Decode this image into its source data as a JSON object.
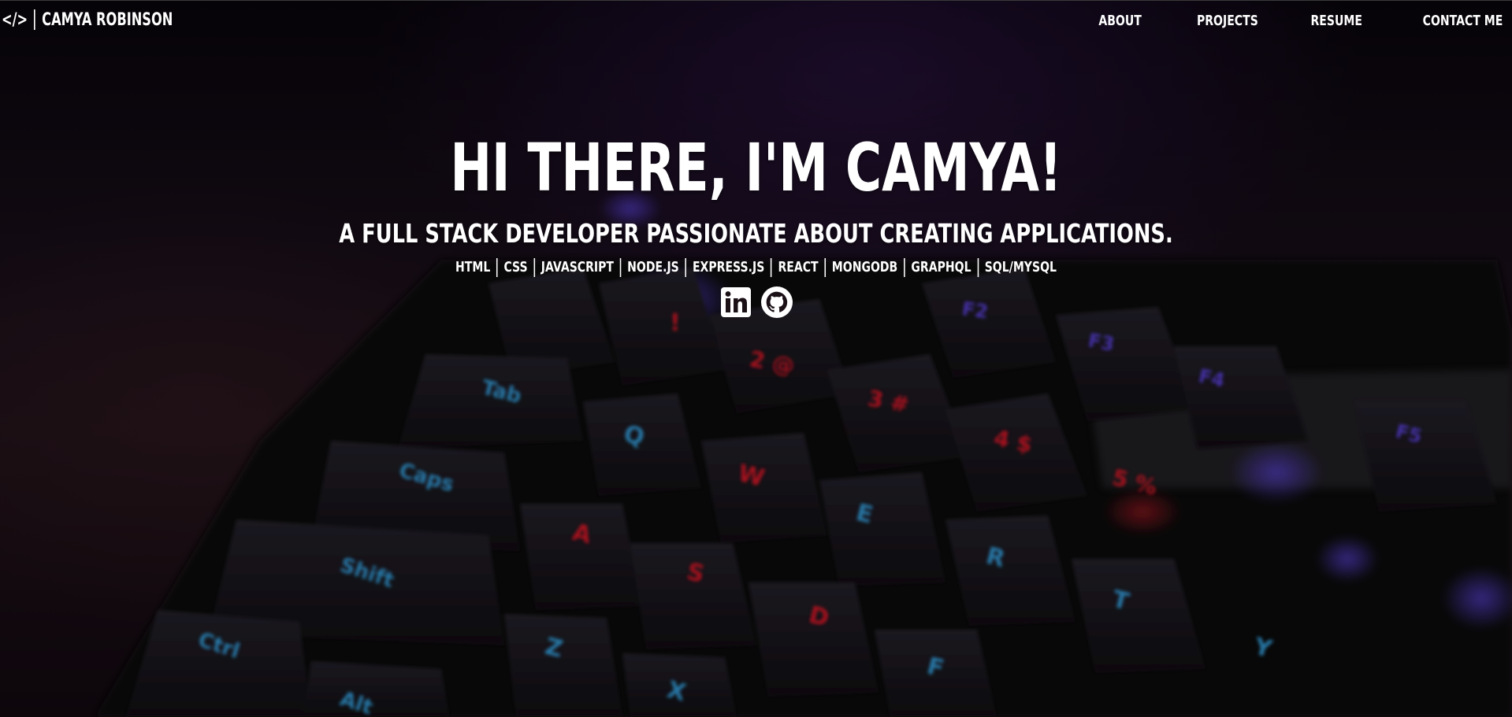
{
  "nav": {
    "brand_code": "</>",
    "brand_name": "CAMYA ROBINSON",
    "links": [
      {
        "label": "ABOUT"
      },
      {
        "label": "PROJECTS"
      },
      {
        "label": "RESUME"
      },
      {
        "label": "CONTACT ME"
      }
    ]
  },
  "hero": {
    "title": "HI THERE, I'M CAMYA!",
    "subtitle": "A FULL STACK DEVELOPER PASSIONATE ABOUT CREATING APPLICATIONS.",
    "skills": [
      "HTML",
      "CSS",
      "JAVASCRIPT",
      "NODE.JS",
      "EXPRESS.JS",
      "REACT",
      "MONGODB",
      "GRAPHQL",
      "SQL/MYSQL"
    ]
  },
  "socials": [
    {
      "icon": "linkedin-icon"
    },
    {
      "icon": "github-icon"
    }
  ],
  "colors": {
    "text": "#ffffff",
    "key_red": "#ff1e2d",
    "key_blue": "#3db8ff",
    "key_violet": "#6a4cff"
  },
  "keyboard": {
    "keys": [
      "Tab",
      "Q",
      "Caps",
      "Shift",
      "Ctrl",
      "Alt",
      "A",
      "S",
      "D",
      "F",
      "Z",
      "X",
      "W",
      "E",
      "R",
      "T",
      "Y",
      "2 @",
      "3 #",
      "4 $",
      "5 %",
      "!",
      "F2",
      "F3",
      "F4",
      "F5"
    ]
  }
}
